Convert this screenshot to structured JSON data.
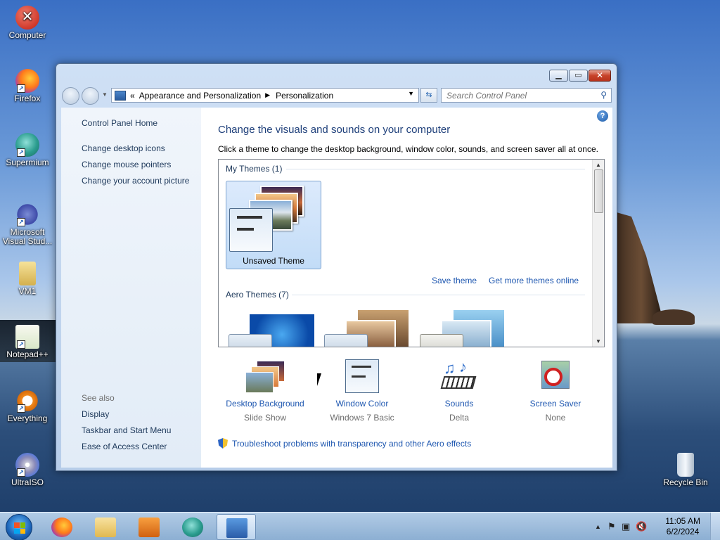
{
  "desktop": {
    "icons": [
      {
        "label": "Computer",
        "icon": "error-x-icon"
      },
      {
        "label": "Firefox",
        "icon": "firefox-icon"
      },
      {
        "label": "Supermium",
        "icon": "supermium-icon"
      },
      {
        "label": "Microsoft Visual Stud...",
        "icon": "visual-studio-icon"
      },
      {
        "label": "VM1",
        "icon": "user-folder-icon"
      },
      {
        "label": "Notepad++",
        "icon": "notepad-plus-plus-icon"
      },
      {
        "label": "Everything",
        "icon": "everything-search-icon"
      },
      {
        "label": "UltraISO",
        "icon": "ultraiso-disc-icon"
      },
      {
        "label": "Recycle Bin",
        "icon": "recycle-bin-icon"
      }
    ]
  },
  "window": {
    "breadcrumb": [
      "Appearance and Personalization",
      "Personalization"
    ],
    "breadcrumb_prefix": "«",
    "search_placeholder": "Search Control Panel",
    "help_glyph": "?"
  },
  "sidebar": {
    "home": "Control Panel Home",
    "links": [
      "Change desktop icons",
      "Change mouse pointers",
      "Change your account picture"
    ],
    "see_also_label": "See also",
    "see_also": [
      "Display",
      "Taskbar and Start Menu",
      "Ease of Access Center"
    ]
  },
  "main": {
    "title": "Change the visuals and sounds on your computer",
    "subtitle": "Click a theme to change the desktop background, window color, sounds, and screen saver all at once.",
    "my_themes_header": "My Themes (1)",
    "aero_themes_header": "Aero Themes (7)",
    "selected_theme": "Unsaved Theme",
    "save_theme": "Save theme",
    "get_more": "Get more themes online"
  },
  "bottom": [
    {
      "label": "Desktop Background",
      "value": "Slide Show"
    },
    {
      "label": "Window Color",
      "value": "Windows 7 Basic"
    },
    {
      "label": "Sounds",
      "value": "Delta"
    },
    {
      "label": "Screen Saver",
      "value": "None"
    }
  ],
  "troubleshoot": "Troubleshoot problems with transparency and other Aero effects",
  "taskbar": {
    "time": "11:05 AM",
    "date": "6/2/2024",
    "apps": [
      "firefox-icon",
      "file-explorer-icon",
      "media-player-icon",
      "supermium-icon",
      "control-panel-icon"
    ]
  },
  "colors": {
    "link": "#1e57b0",
    "title": "#1e3f7a",
    "close_red": "#c7432a"
  }
}
